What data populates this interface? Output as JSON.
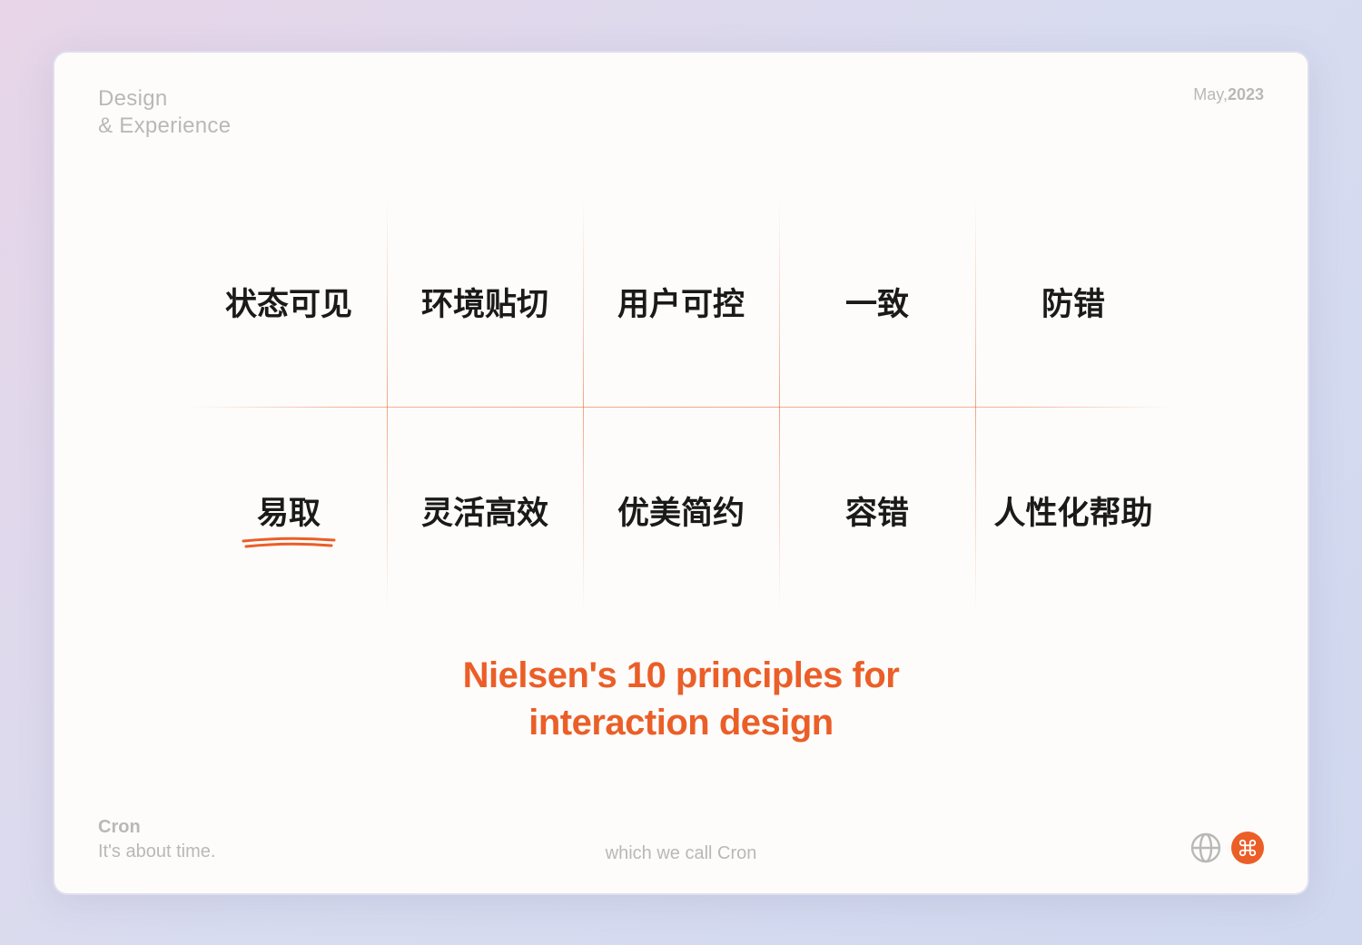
{
  "header": {
    "line1": "Design",
    "line2": "& Experience",
    "date_month": "May,",
    "date_year": "2023"
  },
  "principles": {
    "row1": [
      "状态可见",
      "环境贴切",
      "用户可控",
      "一致",
      "防错"
    ],
    "row2": [
      "易取",
      "灵活高效",
      "优美简约",
      "容错",
      "人性化帮助"
    ],
    "highlighted_index": 0
  },
  "title": {
    "line1": "Nielsen's 10 principles for",
    "line2": "interaction design"
  },
  "footer": {
    "brand": "Cron",
    "tagline": "It's about time.",
    "center": "which we call Cron"
  },
  "colors": {
    "accent": "#eb5e28",
    "muted": "#b8b8b8",
    "text": "#1a1a1a"
  },
  "icons": {
    "globe": "globe-icon",
    "command": "command-icon"
  }
}
